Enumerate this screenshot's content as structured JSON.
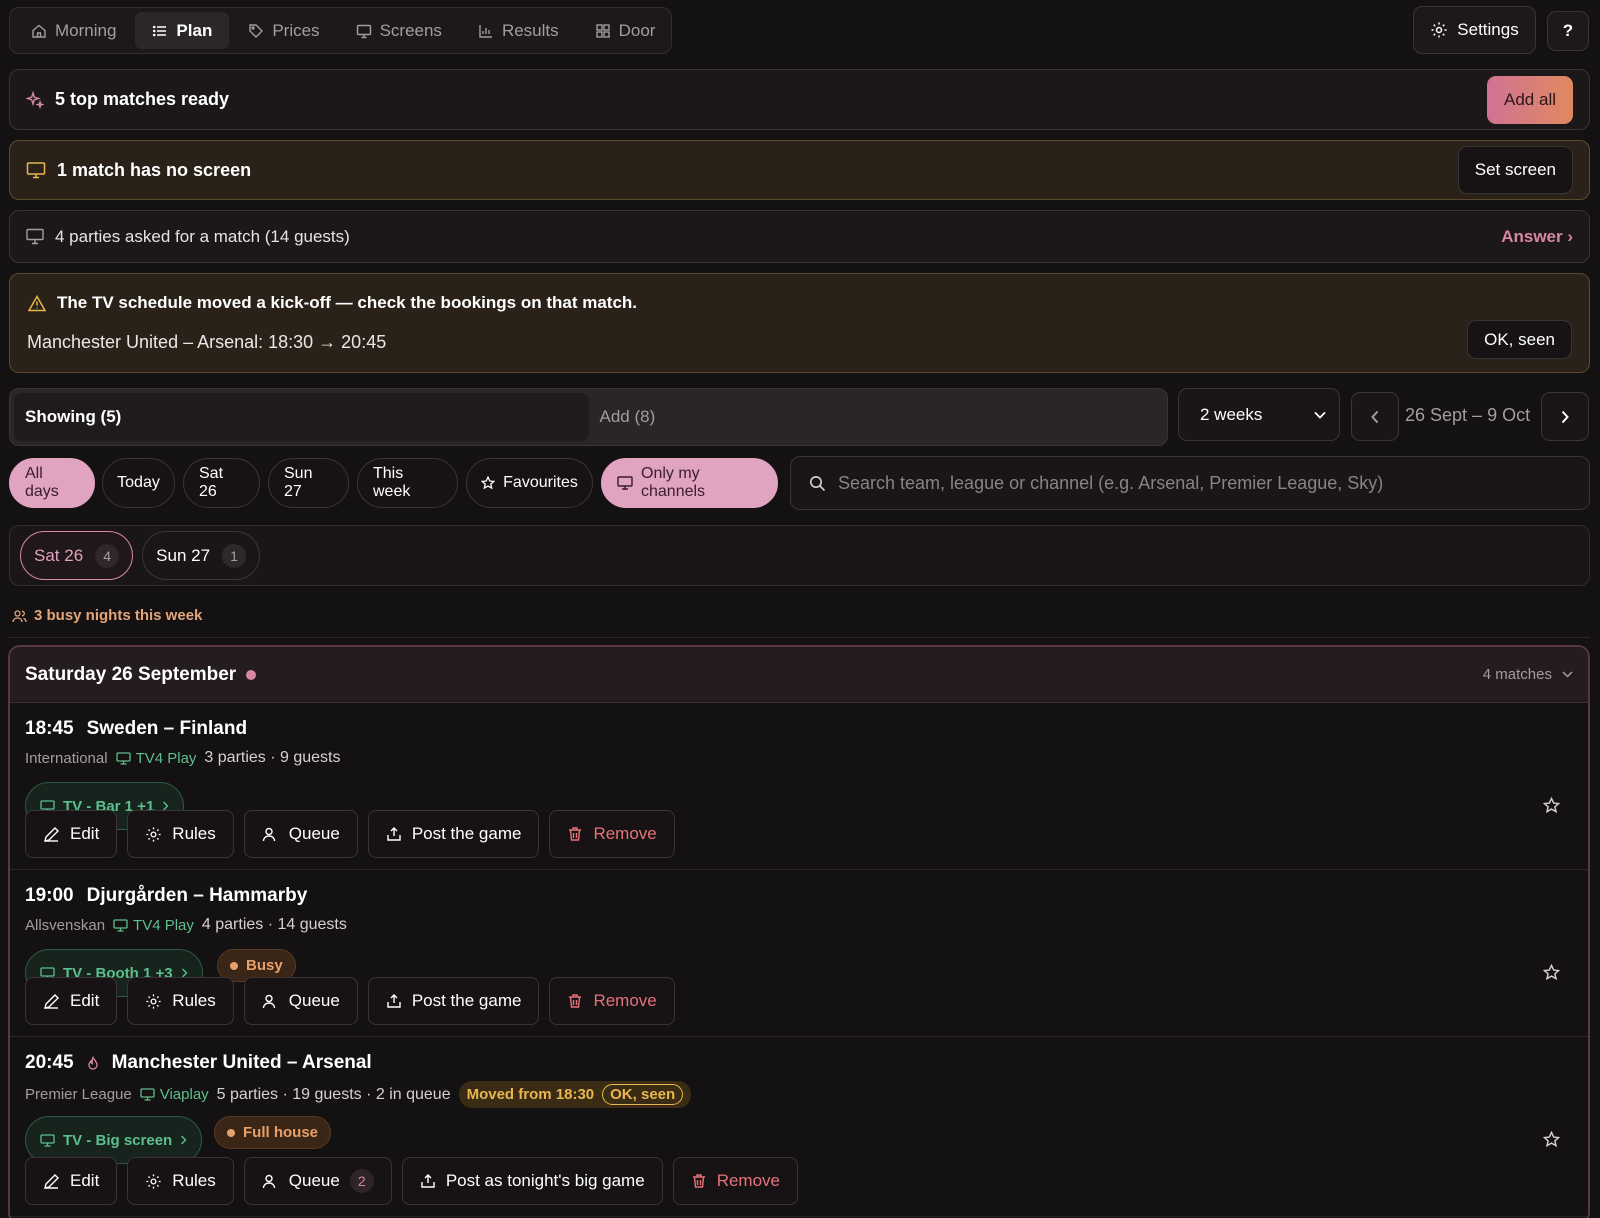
{
  "nav": {
    "tabs": [
      {
        "label": "Morning",
        "icon": "home-icon"
      },
      {
        "label": "Plan",
        "icon": "list-icon"
      },
      {
        "label": "Prices",
        "icon": "tag-icon"
      },
      {
        "label": "Screens",
        "icon": "monitor-icon"
      },
      {
        "label": "Results",
        "icon": "bar-chart-icon"
      },
      {
        "label": "Door",
        "icon": "grid-icon"
      }
    ],
    "active": "Plan",
    "settings_label": "Settings",
    "help_label": "?"
  },
  "banners": {
    "top_matches": {
      "text": "5 top matches ready",
      "button": "Add all"
    },
    "no_screen": {
      "text": "1 match has no screen",
      "button": "Set screen"
    },
    "requests": {
      "text": "4 parties asked for a match (14 guests)",
      "link": "Answer ›"
    },
    "schedule": {
      "title": "The TV schedule moved a kick-off — check the bookings on that match.",
      "detail": "Manchester United – Arsenal: 18:30 → 20:45",
      "button": "OK, seen"
    }
  },
  "view": {
    "showing_label": "Showing (5)",
    "add_label": "Add (8)",
    "range_select": "2 weeks",
    "date_range": "26 Sept – 9 Oct"
  },
  "filters": {
    "chips": [
      "All days",
      "Today",
      "Sat 26",
      "Sun 27",
      "This week",
      "Favourites",
      "Only my channels"
    ],
    "search_placeholder": "Search team, league or channel (e.g. Arsenal, Premier League, Sky)"
  },
  "day_tabs": [
    {
      "label": "Sat 26",
      "count": "4"
    },
    {
      "label": "Sun 27",
      "count": "1"
    }
  ],
  "busy_note": "3 busy nights this week",
  "day": {
    "title": "Saturday 26 September",
    "count": "4 matches",
    "matches": [
      {
        "time": "18:45",
        "name": "Sweden – Finland",
        "league": "International",
        "channel": "TV4 Play",
        "stats": "3 parties · 9 guests",
        "screen": "TV - Bar 1 +1",
        "actions": [
          "Edit",
          "Rules",
          "Queue",
          "Post the game",
          "Remove"
        ]
      },
      {
        "time": "19:00",
        "name": "Djurgården – Hammarby",
        "league": "Allsvenskan",
        "channel": "TV4 Play",
        "stats": "4 parties · 14 guests",
        "screen": "TV - Booth 1 +3",
        "status": "Busy",
        "actions": [
          "Edit",
          "Rules",
          "Queue",
          "Post the game",
          "Remove"
        ]
      },
      {
        "time": "20:45",
        "name": "Manchester United – Arsenal",
        "league": "Premier League",
        "channel": "Viaplay",
        "stats": "5 parties · 19 guests · 2 in queue",
        "moved": "Moved from 18:30",
        "moved_ok": "OK, seen",
        "screen": "TV - Big screen",
        "status": "Full house",
        "queue_count": "2",
        "actions": [
          "Edit",
          "Rules",
          "Queue",
          "Post as tonight's big game",
          "Remove"
        ]
      }
    ]
  },
  "colors": {
    "accent_pink": "#d786a5",
    "accent_green": "#5dbf8c",
    "warning_amber": "#e8b64d",
    "danger": "#e5727a"
  }
}
